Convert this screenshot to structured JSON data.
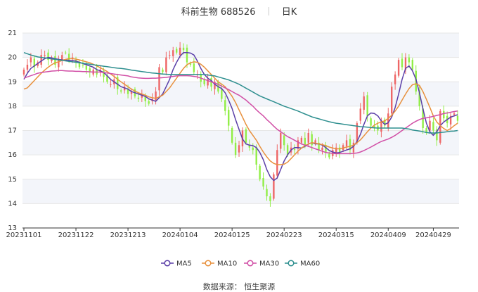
{
  "title": {
    "stock_name": "科前生物",
    "stock_code": "688526",
    "period": "日K"
  },
  "source": "数据来源： 恒生聚源",
  "colors": {
    "up": "#ee6666",
    "down": "#91ee46",
    "ma5": "#5b3fa8",
    "ma10": "#e8913e",
    "ma30": "#d14fa6",
    "ma60": "#2e8f8f",
    "band": "#f3f5fa",
    "grid": "#e6e6e6"
  },
  "chart_data": {
    "type": "candlestick",
    "title": "科前生物 688526 日K",
    "y_range": [
      13,
      21
    ],
    "y_ticks": [
      13,
      14,
      15,
      16,
      17,
      18,
      19,
      20,
      21
    ],
    "x_tick_labels": [
      "20231101",
      "20231122",
      "20231213",
      "20240104",
      "20240125",
      "20240223",
      "20240315",
      "20240409",
      "20240429"
    ],
    "x_tick_positions": [
      0,
      15,
      30,
      45,
      60,
      75,
      90,
      105,
      118
    ],
    "legend_position": "bottom",
    "legend": [
      "MA5",
      "MA10",
      "MA30",
      "MA60"
    ],
    "candle_closes": [
      19.5,
      19.7,
      20.0,
      19.6,
      19.8,
      20.1,
      20.1,
      19.9,
      20.0,
      19.7,
      19.9,
      20.1,
      20.2,
      19.9,
      20.0,
      19.8,
      19.6,
      19.7,
      19.5,
      19.4,
      19.5,
      19.3,
      19.5,
      19.2,
      19.0,
      18.9,
      19.1,
      18.7,
      18.6,
      18.8,
      18.5,
      18.6,
      18.4,
      18.3,
      18.5,
      18.2,
      18.1,
      18.3,
      18.6,
      19.6,
      19.4,
      20.0,
      20.1,
      20.3,
      20.2,
      20.4,
      20.3,
      19.8,
      19.7,
      19.4,
      19.3,
      19.0,
      18.9,
      19.1,
      18.8,
      19.0,
      18.6,
      18.3,
      17.8,
      17.2,
      16.5,
      16.0,
      16.4,
      17.0,
      16.5,
      16.3,
      16.2,
      15.6,
      15.0,
      14.7,
      14.3,
      14.1,
      15.2,
      16.2,
      16.9,
      16.4,
      16.0,
      16.3,
      16.2,
      16.6,
      16.7,
      16.4,
      16.9,
      16.4,
      16.6,
      16.2,
      16.3,
      16.1,
      15.9,
      16.2,
      16.3,
      16.1,
      16.4,
      16.6,
      16.2,
      16.5,
      17.3,
      17.9,
      18.4,
      17.6,
      17.2,
      17.1,
      17.0,
      17.4,
      17.2,
      17.7,
      18.8,
      19.3,
      19.9,
      19.6,
      20.0,
      19.8,
      19.5,
      18.6,
      18.0,
      17.1,
      16.9,
      17.4,
      17.0,
      16.6,
      17.8,
      17.5,
      17.3,
      17.6,
      17.7,
      17.4
    ],
    "series": [
      {
        "name": "MA5",
        "values": [
          19.1,
          19.35,
          19.55,
          19.65,
          19.75,
          19.85,
          19.95,
          20.0,
          19.98,
          19.95,
          19.92,
          19.9,
          19.9,
          19.88,
          19.87,
          19.85,
          19.8,
          19.75,
          19.7,
          19.65,
          19.6,
          19.5,
          19.45,
          19.38,
          19.25,
          19.1,
          19.0,
          18.9,
          18.8,
          18.75,
          18.7,
          18.6,
          18.55,
          18.5,
          18.45,
          18.4,
          18.3,
          18.25,
          18.2,
          18.35,
          18.5,
          18.8,
          19.1,
          19.5,
          19.8,
          20.05,
          20.2,
          20.2,
          20.18,
          20.1,
          19.85,
          19.55,
          19.3,
          19.15,
          19.05,
          18.9,
          18.8,
          18.72,
          18.55,
          18.25,
          17.9,
          17.45,
          17.05,
          16.65,
          16.45,
          16.4,
          16.38,
          16.3,
          16.1,
          15.8,
          15.4,
          15.1,
          14.95,
          15.05,
          15.4,
          15.75,
          16.0,
          16.2,
          16.3,
          16.3,
          16.28,
          16.35,
          16.45,
          16.5,
          16.45,
          16.45,
          16.4,
          16.3,
          16.18,
          16.12,
          16.08,
          16.1,
          16.15,
          16.2,
          16.25,
          16.35,
          16.55,
          16.85,
          17.25,
          17.6,
          17.72,
          17.7,
          17.6,
          17.4,
          17.25,
          17.32,
          17.55,
          17.95,
          18.5,
          19.1,
          19.55,
          19.65,
          19.45,
          19.1,
          18.55,
          17.9,
          17.3,
          16.95,
          16.8,
          16.95,
          17.2,
          17.35,
          17.45,
          17.55,
          17.6,
          17.65
        ]
      },
      {
        "name": "MA10",
        "values": [
          18.7,
          18.75,
          18.9,
          19.05,
          19.2,
          19.35,
          19.48,
          19.6,
          19.7,
          19.78,
          19.82,
          19.88,
          19.92,
          19.95,
          19.95,
          19.93,
          19.9,
          19.86,
          19.82,
          19.78,
          19.72,
          19.65,
          19.58,
          19.5,
          19.42,
          19.32,
          19.22,
          19.1,
          19.0,
          18.9,
          18.8,
          18.7,
          18.62,
          18.55,
          18.5,
          18.45,
          18.38,
          18.35,
          18.32,
          18.38,
          18.45,
          18.6,
          18.75,
          18.95,
          19.15,
          19.35,
          19.55,
          19.7,
          19.78,
          19.82,
          19.8,
          19.72,
          19.6,
          19.45,
          19.3,
          19.15,
          19.0,
          18.9,
          18.8,
          18.6,
          18.4,
          18.15,
          17.85,
          17.55,
          17.25,
          17.0,
          16.8,
          16.6,
          16.35,
          16.12,
          15.92,
          15.75,
          15.65,
          15.6,
          15.6,
          15.62,
          15.7,
          15.85,
          16.0,
          16.15,
          16.28,
          16.38,
          16.45,
          16.5,
          16.48,
          16.45,
          16.42,
          16.38,
          16.32,
          16.28,
          16.25,
          16.25,
          16.28,
          16.32,
          16.35,
          16.4,
          16.5,
          16.62,
          16.78,
          16.95,
          17.1,
          17.22,
          17.3,
          17.35,
          17.4,
          17.5,
          17.62,
          17.8,
          18.0,
          18.25,
          18.5,
          18.72,
          18.88,
          18.92,
          18.85,
          18.6,
          18.28,
          17.95,
          17.6,
          17.35,
          17.2,
          17.08,
          17.0,
          17.08,
          17.2,
          17.3
        ]
      },
      {
        "name": "MA30",
        "values": [
          19.15,
          19.2,
          19.25,
          19.3,
          19.35,
          19.38,
          19.4,
          19.42,
          19.44,
          19.45,
          19.46,
          19.46,
          19.45,
          19.44,
          19.44,
          19.43,
          19.43,
          19.42,
          19.42,
          19.41,
          19.4,
          19.4,
          19.4,
          19.38,
          19.36,
          19.34,
          19.32,
          19.3,
          19.28,
          19.26,
          19.24,
          19.2,
          19.18,
          19.16,
          19.15,
          19.14,
          19.14,
          19.15,
          19.15,
          19.16,
          19.17,
          19.18,
          19.2,
          19.22,
          19.24,
          19.25,
          19.25,
          19.25,
          19.24,
          19.22,
          19.2,
          19.15,
          19.1,
          19.05,
          19.0,
          18.95,
          18.9,
          18.82,
          18.75,
          18.68,
          18.6,
          18.52,
          18.45,
          18.35,
          18.25,
          18.12,
          18.0,
          17.85,
          17.72,
          17.6,
          17.45,
          17.32,
          17.18,
          17.05,
          16.95,
          16.85,
          16.75,
          16.68,
          16.6,
          16.52,
          16.45,
          16.4,
          16.35,
          16.3,
          16.25,
          16.2,
          16.15,
          16.1,
          16.08,
          16.06,
          16.05,
          16.05,
          16.05,
          16.05,
          16.05,
          16.06,
          16.08,
          16.12,
          16.18,
          16.25,
          16.32,
          16.4,
          16.48,
          16.55,
          16.6,
          16.65,
          16.72,
          16.8,
          16.9,
          17.0,
          17.1,
          17.2,
          17.3,
          17.38,
          17.45,
          17.5,
          17.52,
          17.55,
          17.58,
          17.62,
          17.65,
          17.7,
          17.72,
          17.75,
          17.78,
          17.8
        ]
      },
      {
        "name": "MA60",
        "values": [
          20.2,
          20.15,
          20.1,
          20.06,
          20.02,
          20.0,
          19.98,
          19.96,
          19.94,
          19.92,
          19.9,
          19.88,
          19.86,
          19.84,
          19.82,
          19.8,
          19.78,
          19.76,
          19.74,
          19.72,
          19.7,
          19.68,
          19.66,
          19.64,
          19.62,
          19.6,
          19.58,
          19.56,
          19.55,
          19.53,
          19.51,
          19.48,
          19.46,
          19.44,
          19.42,
          19.4,
          19.38,
          19.36,
          19.35,
          19.33,
          19.32,
          19.31,
          19.3,
          19.3,
          19.3,
          19.3,
          19.3,
          19.3,
          19.3,
          19.3,
          19.3,
          19.3,
          19.3,
          19.28,
          19.26,
          19.24,
          19.2,
          19.16,
          19.12,
          19.08,
          19.02,
          18.96,
          18.9,
          18.82,
          18.74,
          18.66,
          18.58,
          18.5,
          18.42,
          18.36,
          18.3,
          18.24,
          18.18,
          18.12,
          18.06,
          18.0,
          17.95,
          17.9,
          17.85,
          17.8,
          17.74,
          17.68,
          17.62,
          17.56,
          17.52,
          17.48,
          17.44,
          17.4,
          17.36,
          17.33,
          17.3,
          17.28,
          17.26,
          17.24,
          17.22,
          17.2,
          17.18,
          17.16,
          17.15,
          17.14,
          17.12,
          17.11,
          17.1,
          17.1,
          17.1,
          17.1,
          17.1,
          17.1,
          17.1,
          17.1,
          17.08,
          17.06,
          17.02,
          17.0,
          16.98,
          16.95,
          16.92,
          16.9,
          16.9,
          16.9,
          16.92,
          16.93,
          16.95,
          16.97,
          16.98,
          17.0
        ]
      }
    ]
  }
}
